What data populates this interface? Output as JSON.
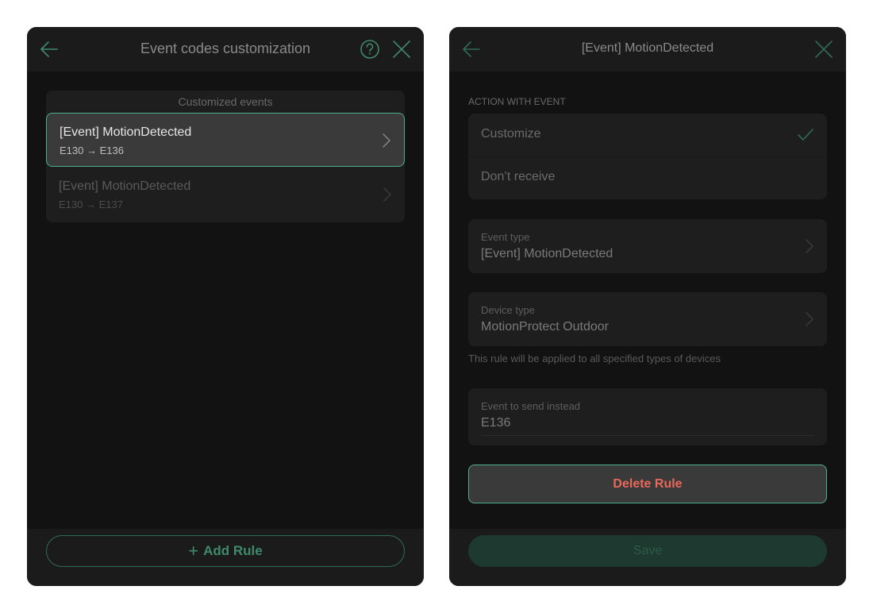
{
  "left_panel": {
    "title": "Event codes customization",
    "section_title": "Customized events",
    "rules": [
      {
        "name": "[Event] MotionDetected",
        "codes": "E130 → E136"
      },
      {
        "name": "[Event] MotionDetected",
        "codes": "E130 → E137"
      }
    ],
    "add_rule_label": "Add Rule",
    "add_rule_plus": "+"
  },
  "right_panel": {
    "title": "[Event] MotionDetected",
    "action_caption": "ACTION WITH EVENT",
    "options": [
      "Customize",
      "Don’t receive"
    ],
    "selected_option": "Customize",
    "event_type_label": "Event type",
    "event_type_value": "[Event] MotionDetected",
    "device_type_label": "Device type",
    "device_type_value": "MotionProtect Outdoor",
    "hint": "This rule will be applied to all specified types of devices",
    "send_instead_label": "Event to send instead",
    "send_instead_value": "E136",
    "delete_label": "Delete Rule",
    "save_label": "Save"
  },
  "colors": {
    "accent": "#4fae8a",
    "danger": "#e8695a",
    "panel_bg": "#121212",
    "surface": "#1e1e1e"
  },
  "icons": [
    "arrow-left-icon",
    "help-circle-icon",
    "close-icon",
    "chevron-right-icon",
    "check-icon",
    "plus-icon"
  ]
}
